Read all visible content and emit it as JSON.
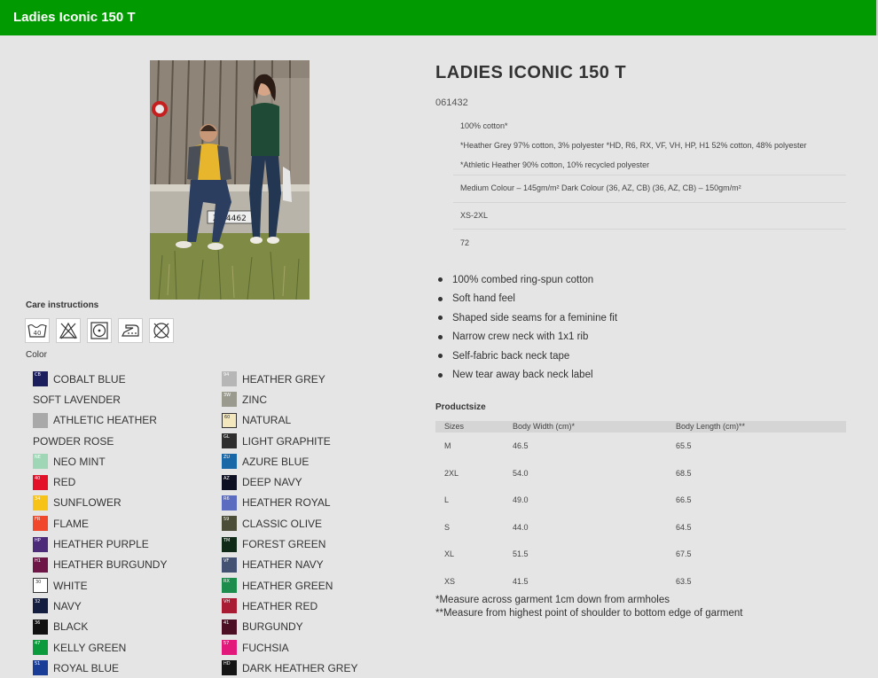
{
  "header": {
    "title": "Ladies Iconic 150 T"
  },
  "product": {
    "title": "LADIES ICONIC 150 T",
    "sku": "061432"
  },
  "specs": {
    "fabric": "100% cotton*",
    "fabric_note_1": "*Heather Grey 97% cotton, 3% polyester *HD, R6, RX, VF, VH, HP, H1 52% cotton, 48% polyester",
    "fabric_note_2": "*Athletic Heather 90% cotton, 10% recycled polyester",
    "weight": "Medium Colour – 145gm/m² Dark Colour (36, AZ, CB) (36, AZ, CB) – 150gm/m²",
    "sizes": "XS-2XL",
    "pack": "72"
  },
  "features": [
    "100% combed ring-spun cotton",
    "Soft hand feel",
    "Shaped side seams for a feminine fit",
    "Narrow crew neck with 1x1 rib",
    "Self-fabric back neck tape",
    "New tear away back neck label"
  ],
  "care": {
    "title": "Care instructions",
    "icons": [
      "wash-40-icon",
      "do-not-bleach-icon",
      "tumble-dry-icon",
      "iron-icon",
      "do-not-dry-clean-icon"
    ],
    "wash_temp": "40"
  },
  "colors": {
    "title": "Color",
    "left": [
      {
        "name": "COBALT BLUE",
        "code": "CB",
        "hex": "#1c1f5e",
        "swatch": true
      },
      {
        "name": "SOFT LAVENDER",
        "code": "",
        "hex": "",
        "swatch": false
      },
      {
        "name": "ATHLETIC HEATHER",
        "code": "",
        "hex": "#a9a9a9",
        "swatch": true
      },
      {
        "name": "POWDER ROSE",
        "code": "",
        "hex": "",
        "swatch": false
      },
      {
        "name": "NEO MINT",
        "code": "NE",
        "hex": "#9fd6b6",
        "swatch": true
      },
      {
        "name": "RED",
        "code": "40",
        "hex": "#e4102a",
        "swatch": true
      },
      {
        "name": "SUNFLOWER",
        "code": "34",
        "hex": "#f8c317",
        "swatch": true
      },
      {
        "name": "FLAME",
        "code": "FR",
        "hex": "#f1472b",
        "swatch": true
      },
      {
        "name": "HEATHER PURPLE",
        "code": "HP",
        "hex": "#4c2c79",
        "swatch": true
      },
      {
        "name": "HEATHER BURGUNDY",
        "code": "H1",
        "hex": "#6e1646",
        "swatch": true
      },
      {
        "name": "WHITE",
        "code": "30",
        "hex": "#ffffff",
        "swatch": true
      },
      {
        "name": "NAVY",
        "code": "32",
        "hex": "#131d40",
        "swatch": true
      },
      {
        "name": "BLACK",
        "code": "36",
        "hex": "#111111",
        "swatch": true
      },
      {
        "name": "KELLY GREEN",
        "code": "47",
        "hex": "#0c9b3c",
        "swatch": true
      },
      {
        "name": "ROYAL BLUE",
        "code": "51",
        "hex": "#1a3e98",
        "swatch": true
      }
    ],
    "right": [
      {
        "name": "HEATHER GREY",
        "code": "94",
        "hex": "#b6b6b6",
        "swatch": true
      },
      {
        "name": "ZINC",
        "code": "3W",
        "hex": "#9a9a8e",
        "swatch": true
      },
      {
        "name": "NATURAL",
        "code": "60",
        "hex": "#f3e7bd",
        "swatch": true
      },
      {
        "name": "LIGHT GRAPHITE",
        "code": "GL",
        "hex": "#2e2e2e",
        "swatch": true
      },
      {
        "name": "AZURE BLUE",
        "code": "ZU",
        "hex": "#1868a8",
        "swatch": true
      },
      {
        "name": "DEEP NAVY",
        "code": "AZ",
        "hex": "#0d0f22",
        "swatch": true
      },
      {
        "name": "HEATHER ROYAL",
        "code": "R6",
        "hex": "#5b6cc0",
        "swatch": true
      },
      {
        "name": "CLASSIC OLIVE",
        "code": "59",
        "hex": "#4b4d36",
        "swatch": true
      },
      {
        "name": "FOREST GREEN",
        "code": "TM",
        "hex": "#0f2a16",
        "swatch": true
      },
      {
        "name": "HEATHER NAVY",
        "code": "VF",
        "hex": "#435273",
        "swatch": true
      },
      {
        "name": "HEATHER GREEN",
        "code": "RX",
        "hex": "#1c8d4c",
        "swatch": true
      },
      {
        "name": "HEATHER RED",
        "code": "VH",
        "hex": "#a81b33",
        "swatch": true
      },
      {
        "name": "BURGUNDY",
        "code": "41",
        "hex": "#4c0e22",
        "swatch": true
      },
      {
        "name": "FUCHSIA",
        "code": "57",
        "hex": "#e2187b",
        "swatch": true
      },
      {
        "name": "DARK HEATHER GREY",
        "code": "HD",
        "hex": "#151515",
        "swatch": true
      }
    ]
  },
  "sizechart": {
    "title": "Productsize",
    "headers": [
      "Sizes",
      "Body Width (cm)*",
      "Body Length (cm)**"
    ],
    "rows": [
      [
        "M",
        "46.5",
        "65.5"
      ],
      [
        "2XL",
        "54.0",
        "68.5"
      ],
      [
        "L",
        "49.0",
        "66.5"
      ],
      [
        "S",
        "44.0",
        "64.5"
      ],
      [
        "XL",
        "51.5",
        "67.5"
      ],
      [
        "XS",
        "41.5",
        "63.5"
      ]
    ],
    "note1": "*Measure across garment 1cm down from armholes",
    "note2": "**Measure from highest point of shoulder to bottom edge of garment"
  },
  "photo": {
    "plate": "Z9  4462"
  },
  "theme": {
    "accent": "#019b01"
  }
}
